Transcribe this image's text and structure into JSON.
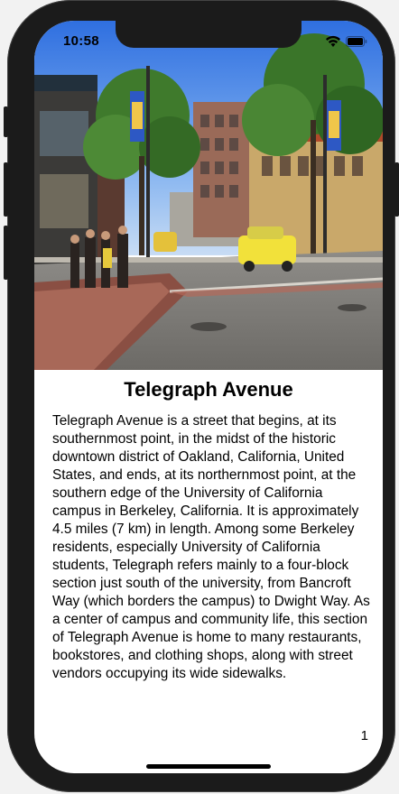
{
  "status_bar": {
    "time": "10:58",
    "icons": [
      "wifi-icon",
      "battery-icon"
    ]
  },
  "hero_image": {
    "subject": "street-scene-photo"
  },
  "article": {
    "title": "Telegraph Avenue",
    "body": "Telegraph Avenue is a street that begins, at its southernmost point, in the midst of the historic downtown district of Oakland, California, United States, and ends, at its northernmost point, at the southern edge of the University of California campus in Berkeley, California. It is approximately 4.5 miles (7 km) in length. Among some Berkeley residents, especially University of California students, Telegraph refers mainly to a four-block section just south of the university, from Bancroft Way (which borders the campus) to Dwight Way. As a center of campus and community life, this section of Telegraph Avenue is home to many restaurants, bookstores, and clothing shops, along with street vendors occupying its wide sidewalks."
  },
  "page_number": "1",
  "colors": {
    "device_frame": "#1b1b1b",
    "screen_background": "#ffffff",
    "text": "#000000"
  }
}
